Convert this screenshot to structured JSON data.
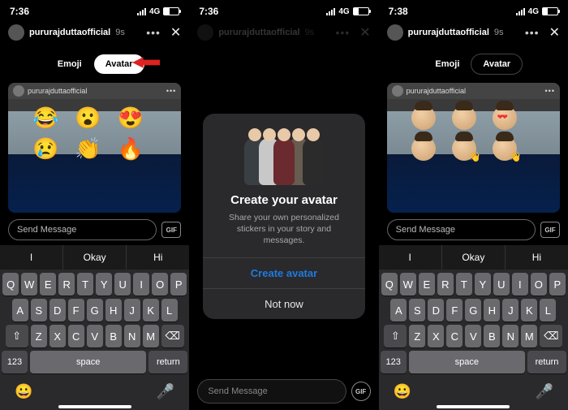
{
  "screens": {
    "left": {
      "time": "7:36",
      "network": "4G",
      "username": "pururajduttaofficial",
      "story_age": "9s",
      "tabs": {
        "emoji": "Emoji",
        "avatar": "Avatar",
        "active": "avatar"
      },
      "reactions_row1": [
        "😂",
        "😮",
        "😍"
      ],
      "reactions_row2": [
        "😢",
        "👏",
        "🔥"
      ],
      "message_placeholder": "Send Message",
      "gif_label": "GIF",
      "suggestions": [
        "I",
        "Okay",
        "Hi"
      ]
    },
    "center": {
      "time": "7:36",
      "network": "4G",
      "username": "pururajduttaofficial",
      "story_age": "9s",
      "modal": {
        "title": "Create your avatar",
        "body": "Share your own personalized stickers in your story and messages.",
        "primary": "Create avatar",
        "secondary": "Not now"
      },
      "message_placeholder": "Send Message",
      "gif_label": "GIF"
    },
    "right": {
      "time": "7:38",
      "network": "4G",
      "username": "pururajduttaofficial",
      "story_age": "9s",
      "tabs": {
        "emoji": "Emoji",
        "avatar": "Avatar",
        "active": "avatar"
      },
      "message_placeholder": "Send Message",
      "gif_label": "GIF",
      "suggestions": [
        "I",
        "Okay",
        "Hi"
      ]
    }
  },
  "keyboard": {
    "row1": [
      "Q",
      "W",
      "E",
      "R",
      "T",
      "Y",
      "U",
      "I",
      "O",
      "P"
    ],
    "row2": [
      "A",
      "S",
      "D",
      "F",
      "G",
      "H",
      "J",
      "K",
      "L"
    ],
    "row3": [
      "Z",
      "X",
      "C",
      "V",
      "B",
      "N",
      "M"
    ],
    "shift": "⇧",
    "backspace": "⌫",
    "numbers": "123",
    "space": "space",
    "return": "return",
    "emoji_key": "😀",
    "mic": "🎤"
  }
}
